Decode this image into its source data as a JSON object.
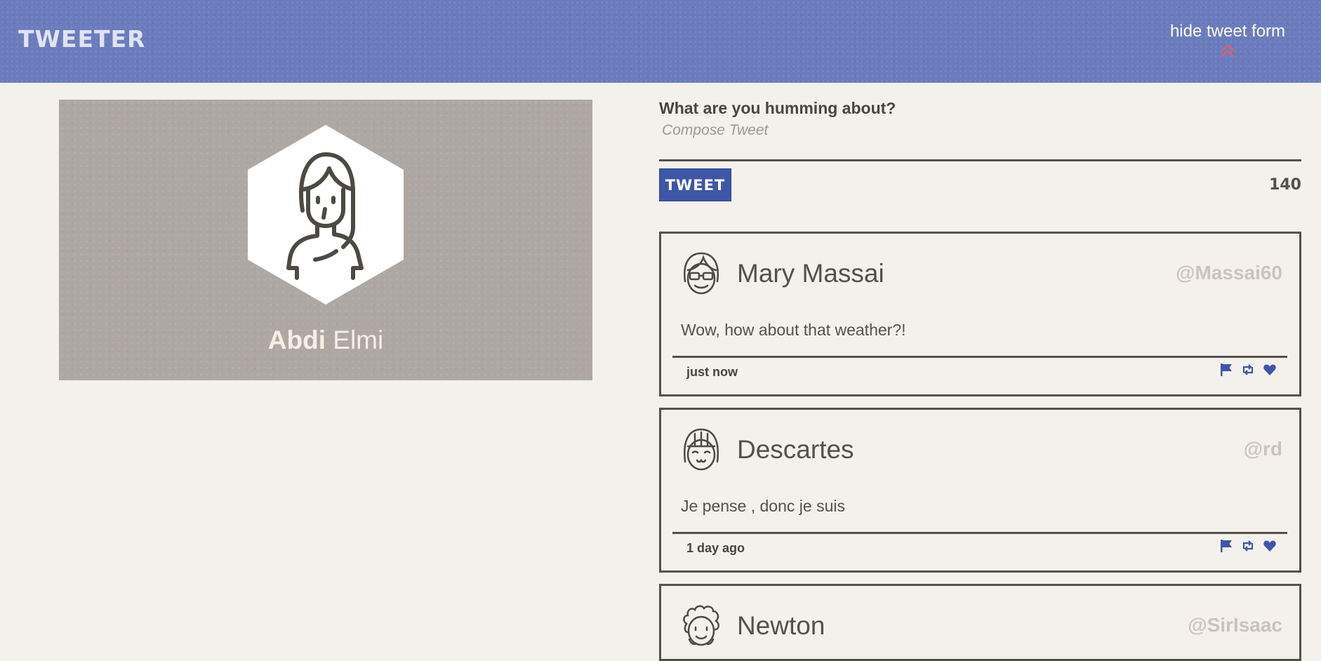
{
  "header": {
    "brand": "TWEETER",
    "toggle_label": "hide tweet form"
  },
  "profile": {
    "first_name": "Abdi",
    "last_name": "Elmi"
  },
  "compose": {
    "title": "What are you humming about?",
    "placeholder": "Compose Tweet",
    "button_label": "TWEET",
    "counter": "140"
  },
  "tweets": [
    {
      "name": "Mary Massai",
      "handle": "@Massai60",
      "text": "Wow, how about that weather?!",
      "time": "just now"
    },
    {
      "name": "Descartes",
      "handle": "@rd",
      "text": "Je pense , donc je suis",
      "time": "1 day ago"
    },
    {
      "name": "Newton",
      "handle": "@SirIsaac",
      "text": "",
      "time": ""
    }
  ],
  "icons": {
    "toggle": "double-chevron-up-icon",
    "tweet_actions": [
      "flag-icon",
      "retweet-icon",
      "heart-icon"
    ]
  },
  "colors": {
    "header": "#6a7cbd",
    "accent": "#3e56a6",
    "toggle_icon": "#e0606b",
    "background": "#f4f1ec",
    "profile_card": "#aea8a5"
  }
}
